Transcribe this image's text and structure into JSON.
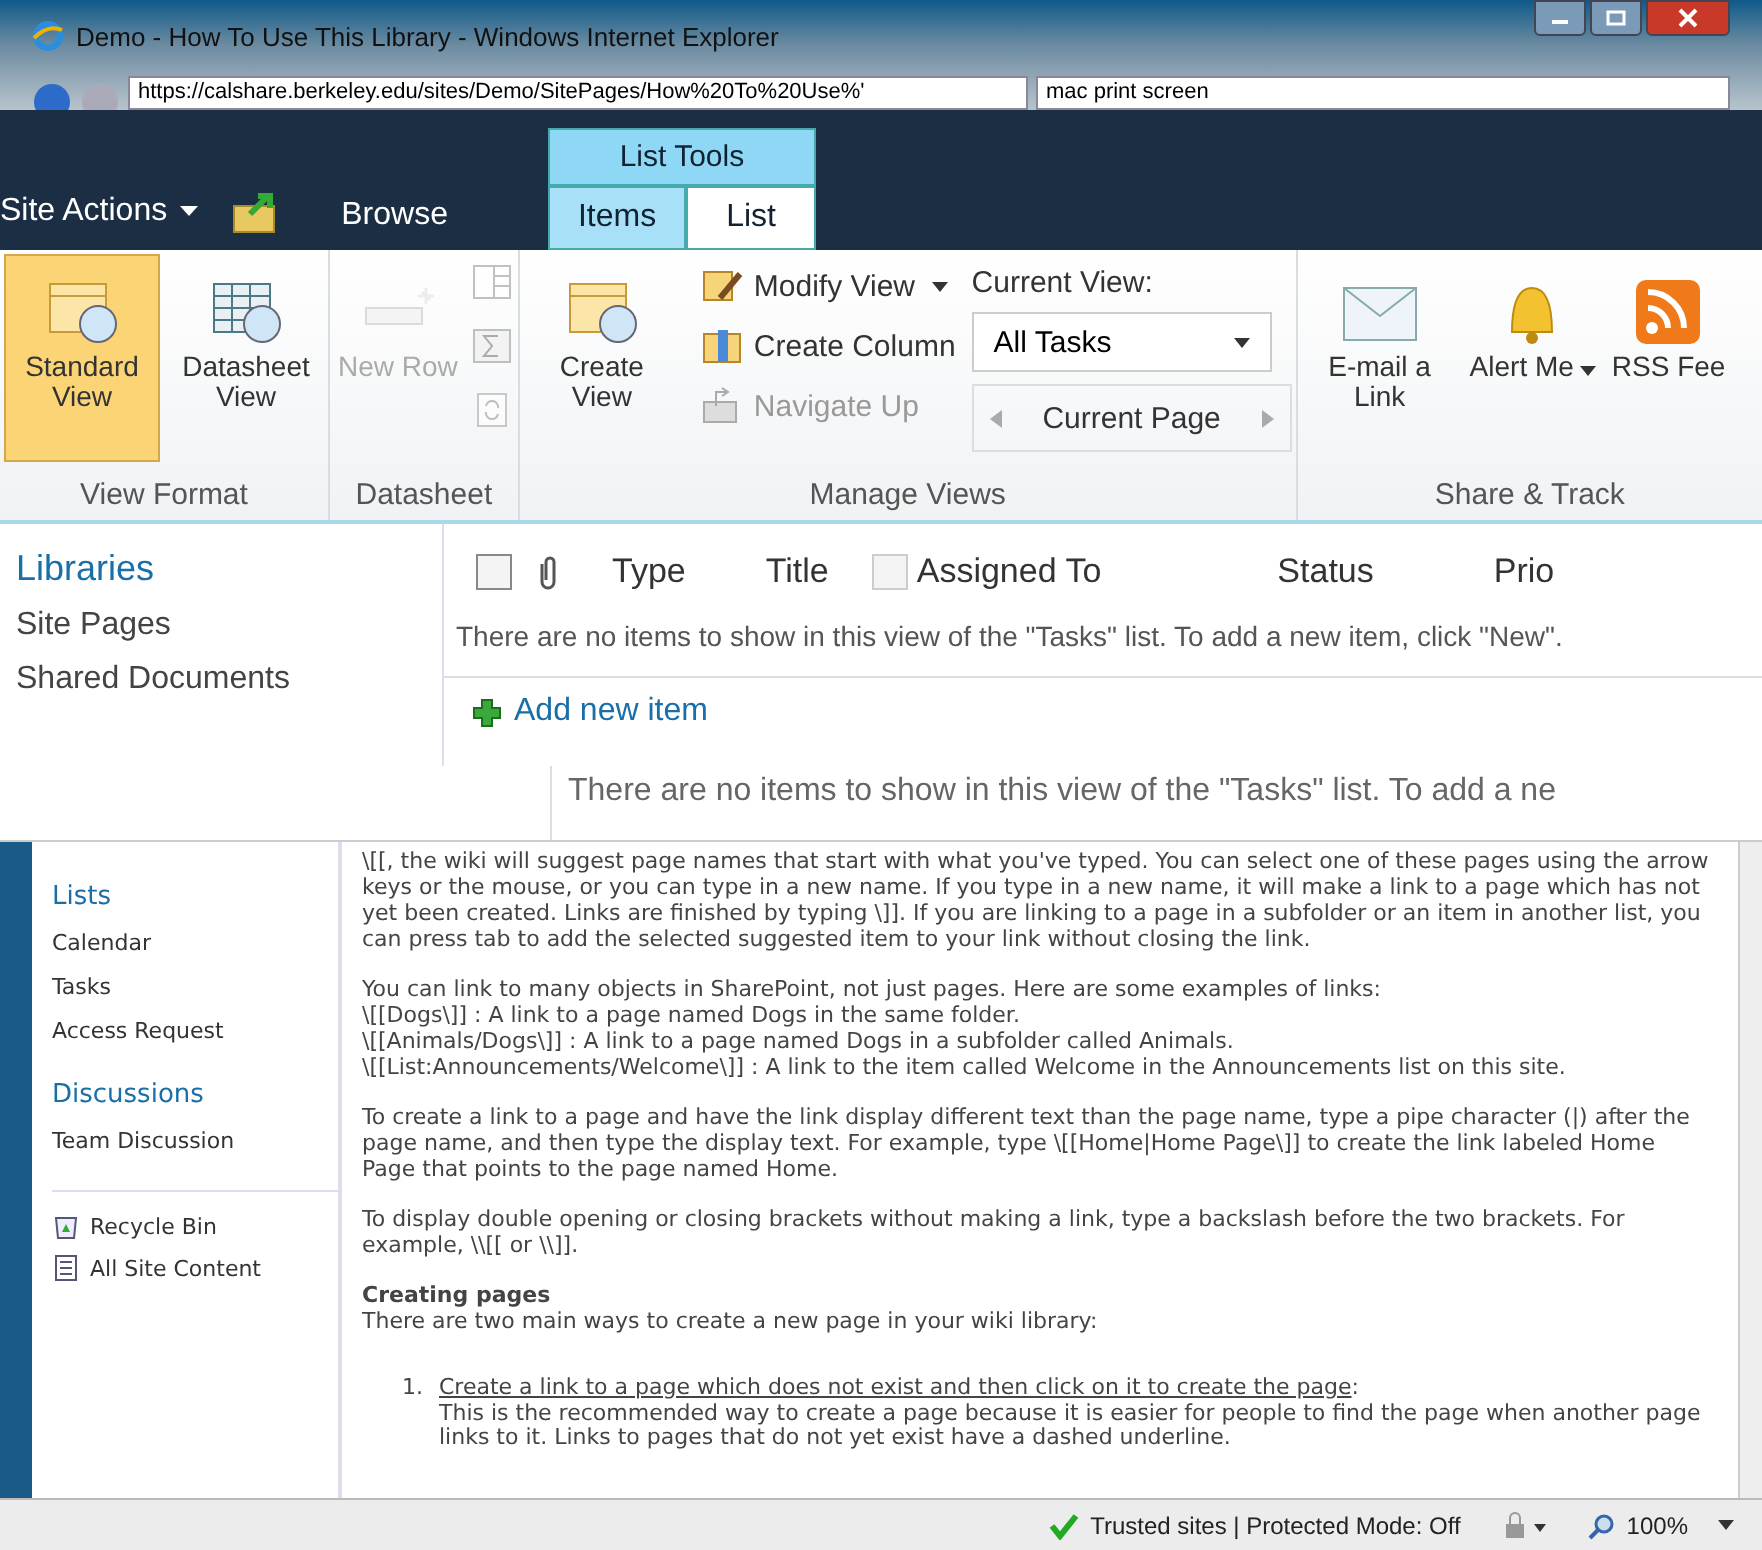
{
  "window": {
    "title": "Demo - How To Use This Library - Windows Internet Explorer",
    "address": "https://calshare.berkeley.edu/sites/Demo/SitePages/How%20To%20Use%'",
    "search": "mac print screen"
  },
  "ribbon_bar": {
    "site_actions": "Site Actions",
    "context_label": "List Tools",
    "tabs": [
      {
        "label": "Browse",
        "selected": false
      }
    ],
    "context_tabs": [
      {
        "label": "Items",
        "selected": false
      },
      {
        "label": "List",
        "selected": true
      }
    ]
  },
  "ribbon": {
    "groups": [
      {
        "label": "View Format",
        "items": [
          {
            "kind": "large",
            "label": "Standard View",
            "selected": true,
            "disabled": false
          },
          {
            "kind": "large",
            "label": "Datasheet View",
            "selected": false,
            "disabled": false
          }
        ]
      },
      {
        "label": "Datasheet",
        "items": [
          {
            "kind": "large",
            "label": "New Row",
            "selected": false,
            "disabled": true
          },
          {
            "kind": "icons",
            "disabled": true
          }
        ]
      },
      {
        "label": "Manage Views",
        "items": [
          {
            "kind": "large",
            "label": "Create View",
            "selected": false,
            "disabled": false
          },
          {
            "kind": "small",
            "label": "Modify View",
            "dropdown": true,
            "selected": false,
            "disabled": false
          },
          {
            "kind": "small",
            "label": "Create Column",
            "dropdown": false,
            "selected": false,
            "disabled": false
          },
          {
            "kind": "small",
            "label": "Navigate Up",
            "dropdown": false,
            "selected": false,
            "disabled": true
          },
          {
            "kind": "view",
            "label": "Current View:",
            "value": "All Tasks",
            "pager": "Current Page",
            "selected": false,
            "disabled": false
          }
        ]
      },
      {
        "label": "Share & Track",
        "items": [
          {
            "kind": "large",
            "label": "E-mail a Link",
            "selected": false,
            "disabled": false
          },
          {
            "kind": "large",
            "label": "Alert Me",
            "dropdown": true,
            "selected": false,
            "disabled": false
          },
          {
            "kind": "large",
            "label": "RSS Fee",
            "selected": false,
            "disabled": false
          }
        ]
      }
    ]
  },
  "quick_launch_top": {
    "heading": "Libraries",
    "items": [
      "Site Pages",
      "Shared Documents"
    ]
  },
  "list_view": {
    "select_all": {
      "checked": false
    },
    "column_checkbox": {
      "checked": false
    },
    "columns": [
      "Type",
      "Title",
      "Assigned To",
      "Status",
      "Prio"
    ],
    "empty_message": "There are no items to show in this view of the \"Tasks\" list. To add a new item, click \"New\".",
    "add_link": "Add new item",
    "echo_message": "There are no items to show in this view of the \"Tasks\" list. To add a ne"
  },
  "quick_launch": {
    "sections": [
      {
        "heading": "Lists",
        "items": [
          "Calendar",
          "Tasks",
          "Access Request"
        ]
      },
      {
        "heading": "Discussions",
        "items": [
          "Team Discussion"
        ]
      }
    ],
    "footer": [
      "Recycle Bin",
      "All Site Content"
    ]
  },
  "content": [
    {
      "kind": "para",
      "lines": [
        "\\[[, the wiki will suggest page names that start with what you've typed. You can select one of these pages using the arrow keys or the mouse, or you can type in a new name. If you type in a new name, it will make a link to a page which has not yet been created. Links are finished by typing \\]]. If you are linking to a page in a subfolder or an item in another list, you can press tab to add the selected suggested item to your link without closing the link."
      ]
    },
    {
      "kind": "para",
      "lines": [
        "You can link to many objects in SharePoint, not just pages. Here are some examples of links:",
        "\\[[Dogs\\]] : A link to a page named Dogs in the same folder.",
        "\\[[Animals/Dogs\\]] : A link to a page named Dogs in a subfolder called Animals.",
        "\\[[List:Announcements/Welcome\\]] : A link to the item called Welcome in the Announcements list on this site."
      ]
    },
    {
      "kind": "para",
      "lines": [
        "To create a link to a page and have the link display different text than the page name, type a pipe character (|) after the page name, and then type the display text. For example, type \\[[Home|Home Page\\]] to create the link labeled Home Page that points to the page named Home."
      ]
    },
    {
      "kind": "para",
      "lines": [
        "To display double opening or closing brackets without making a link, type a backslash before the two brackets. For example, \\\\[[ or \\\\]]."
      ]
    },
    {
      "kind": "heading",
      "title": "Creating pages",
      "lines": [
        "There are two main ways to create a new page in your wiki library:"
      ]
    },
    {
      "kind": "numbered",
      "number": "1.",
      "link": "Create a link to a page which does not exist and then click on it to create the page",
      "suffix": ":",
      "lines": [
        "This is the recommended way to create a page because it is easier for people to find the page when another page links to it. Links to pages that do not yet exist have a dashed underline."
      ]
    }
  ],
  "status_bar": {
    "zone": "Trusted sites | Protected Mode: Off",
    "zoom": "100%"
  }
}
